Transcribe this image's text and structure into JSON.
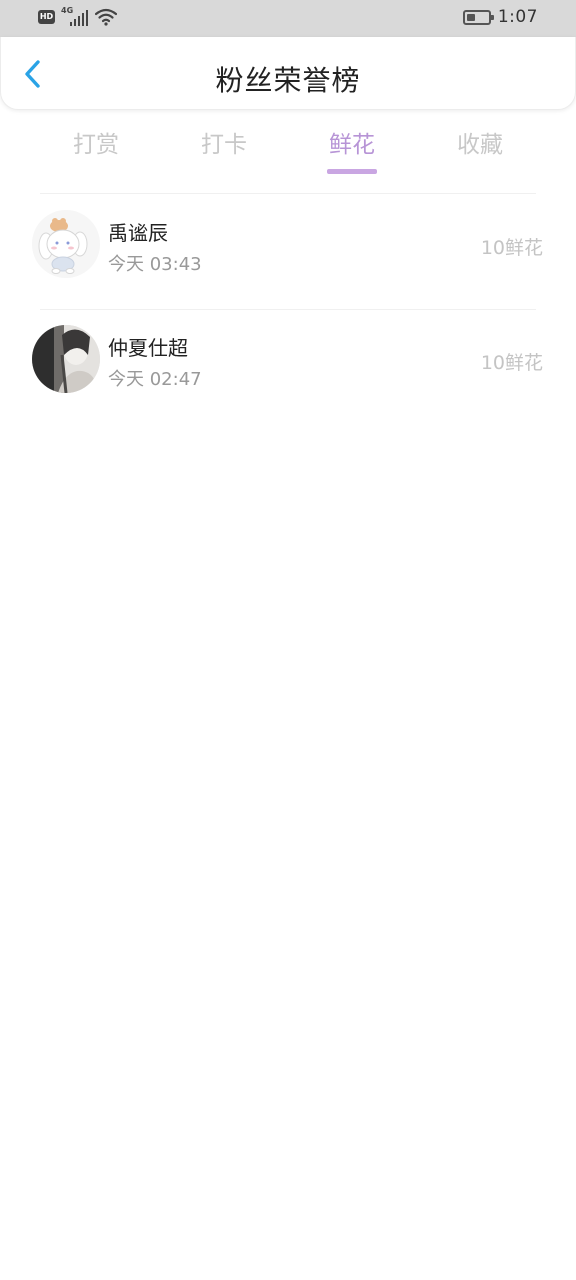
{
  "status_bar": {
    "hd": "HD",
    "network": "4G",
    "time": "1:07",
    "battery_level": 0.35
  },
  "header": {
    "title": "粉丝荣誉榜"
  },
  "tabs": [
    {
      "label": "打赏",
      "active": false
    },
    {
      "label": "打卡",
      "active": false
    },
    {
      "label": "鲜花",
      "active": true
    },
    {
      "label": "收藏",
      "active": false
    }
  ],
  "list": [
    {
      "name": "禹谧辰",
      "time": "今天 03:43",
      "amount": "10鲜花",
      "avatar": "bunny-avatar"
    },
    {
      "name": "仲夏仕超",
      "time": "今天 02:47",
      "amount": "10鲜花",
      "avatar": "photo-avatar"
    }
  ],
  "colors": {
    "accent": "#b794d6",
    "back_arrow": "#2aa3e6",
    "status_bar_bg": "#d9d9d9"
  }
}
